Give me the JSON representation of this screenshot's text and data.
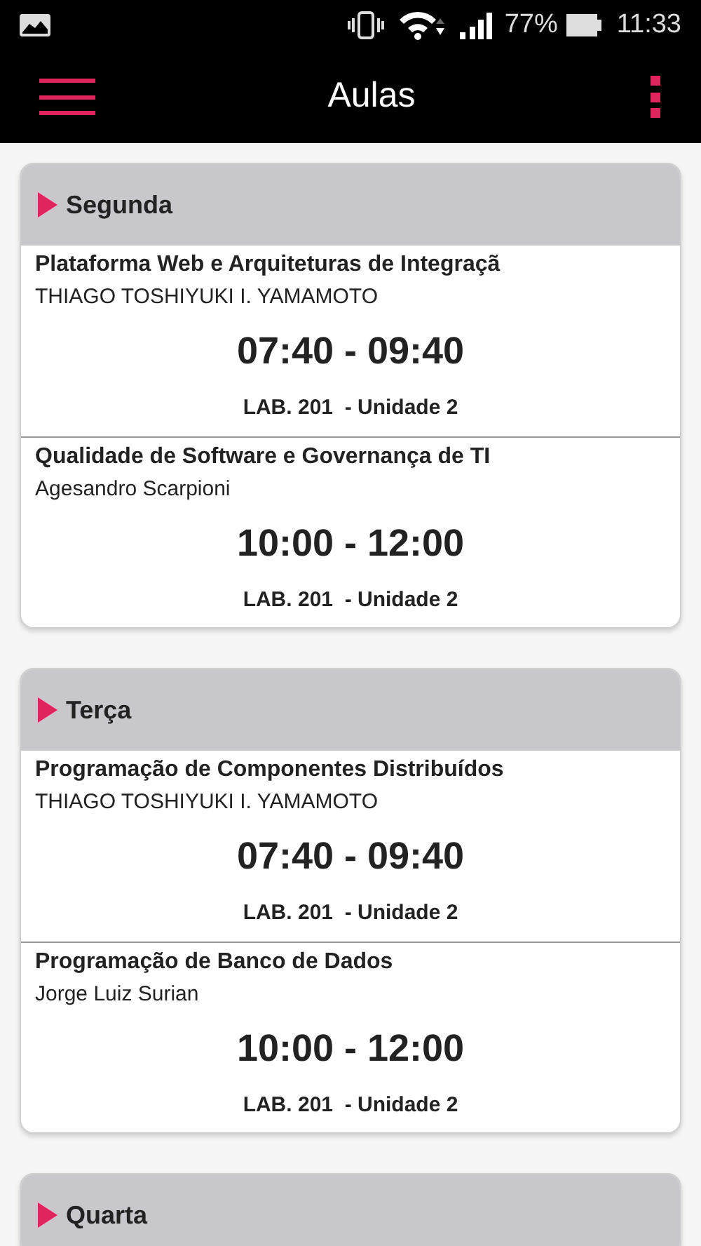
{
  "status_bar": {
    "battery": "77%",
    "time": "11:33"
  },
  "toolbar": {
    "title": "Aulas"
  },
  "days": [
    {
      "name": "Segunda",
      "classes": [
        {
          "title": "Plataforma Web e Arquiteturas de Integraçã",
          "teacher": "THIAGO TOSHIYUKI I. YAMAMOTO",
          "time": "07:40 - 09:40",
          "room": "LAB. 201  - Unidade 2"
        },
        {
          "title": "Qualidade de Software e Governança de TI",
          "teacher": "Agesandro Scarpioni",
          "time": "10:00 - 12:00",
          "room": "LAB. 201  - Unidade 2"
        }
      ]
    },
    {
      "name": "Terça",
      "classes": [
        {
          "title": "Programação de Componentes Distribuídos",
          "teacher": "THIAGO TOSHIYUKI I. YAMAMOTO",
          "time": "07:40 - 09:40",
          "room": "LAB. 201  - Unidade 2"
        },
        {
          "title": "Programação de Banco de Dados",
          "teacher": "Jorge Luiz Surian",
          "time": "10:00 - 12:00",
          "room": "LAB. 201  - Unidade 2"
        }
      ]
    },
    {
      "name": "Quarta"
    }
  ]
}
